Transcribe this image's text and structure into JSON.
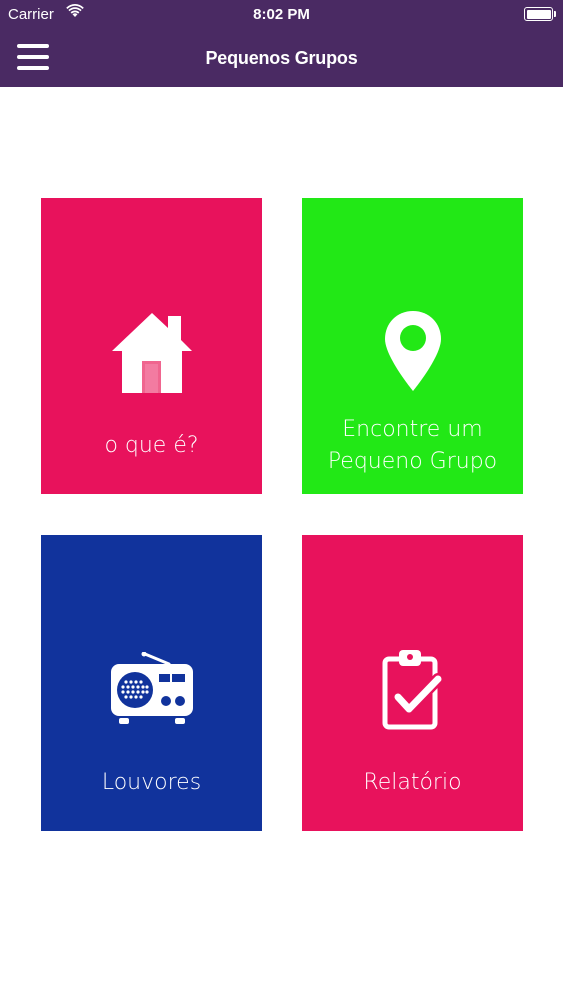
{
  "status_bar": {
    "carrier": "Carrier",
    "time": "8:02 PM"
  },
  "nav": {
    "title": "Pequenos Grupos",
    "menu_icon": "hamburger-menu-icon",
    "background_color": "#4a2a63"
  },
  "tiles": [
    {
      "label": "o que é?",
      "icon": "house-icon",
      "color": "#e8125c"
    },
    {
      "label_line1": "Encontre um",
      "label_line2": "Pequeno Grupo",
      "icon": "map-pin-icon",
      "color": "#22e816"
    },
    {
      "label": "Louvores",
      "icon": "radio-icon",
      "color": "#11339c"
    },
    {
      "label": "Relatório",
      "icon": "clipboard-check-icon",
      "color": "#e8125c"
    }
  ]
}
